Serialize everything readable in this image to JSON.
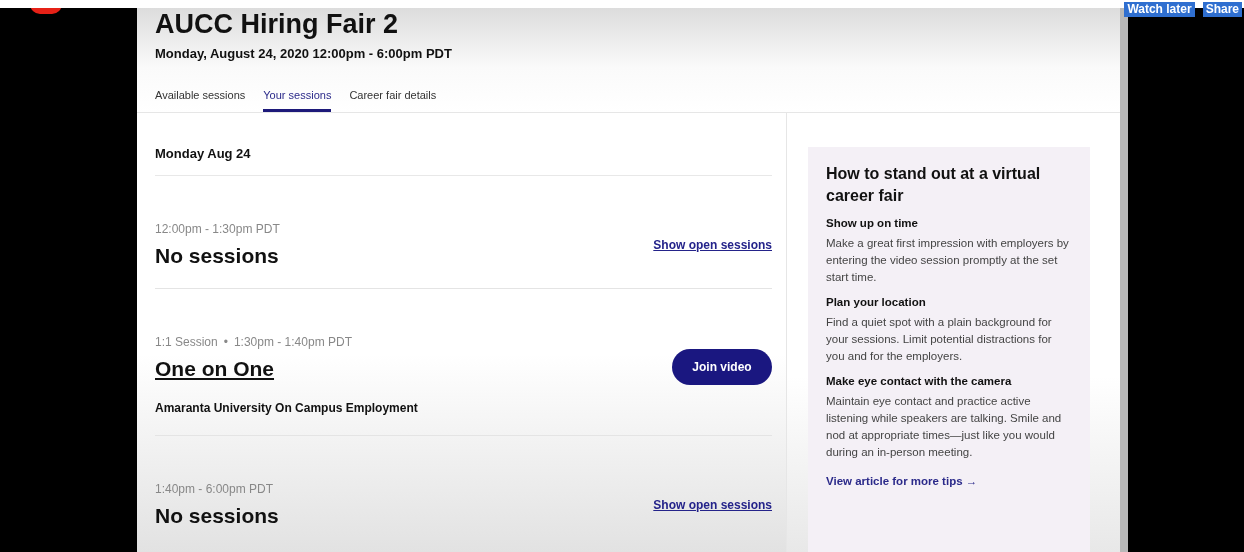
{
  "video_overlay": {
    "buttons": [
      "Watch later",
      "Share"
    ]
  },
  "header": {
    "title": "AUCC Hiring Fair 2",
    "date": "Monday, August 24, 2020 12:00pm - 6:00pm PDT",
    "tabs": [
      {
        "label": "Available sessions",
        "selected": false
      },
      {
        "label": "Your sessions",
        "selected": true
      },
      {
        "label": "Career fair details",
        "selected": false
      }
    ]
  },
  "schedule": {
    "day": "Monday Aug 24",
    "slots": [
      {
        "kind": "empty",
        "time": "12:00pm - 1:30pm PDT",
        "title": "No sessions",
        "link": "Show open sessions"
      },
      {
        "kind": "session",
        "type": "1:1 Session",
        "separator": "•",
        "time": "1:30pm - 1:40pm PDT",
        "title": "One on One",
        "organizer": "Amaranta University On Campus Employment",
        "button": "Join video"
      },
      {
        "kind": "empty",
        "time": "1:40pm - 6:00pm PDT",
        "title": "No sessions",
        "link": "Show open sessions"
      }
    ]
  },
  "tips": {
    "title": "How to stand out at a virtual career fair",
    "sections": [
      {
        "heading": "Show up on time",
        "body": "Make a great first impression with employers by entering the video session promptly at the set start time."
      },
      {
        "heading": "Plan your location",
        "body": "Find a quiet spot with a plain background for your sessions. Limit potential distractions for you and for the employers."
      },
      {
        "heading": "Make eye contact with the camera",
        "body": "Maintain eye contact and practice active listening while speakers are talking. Smile and nod at appropriate times—just like you would during an in-person meeting."
      }
    ],
    "link": "View article for more tips →"
  }
}
